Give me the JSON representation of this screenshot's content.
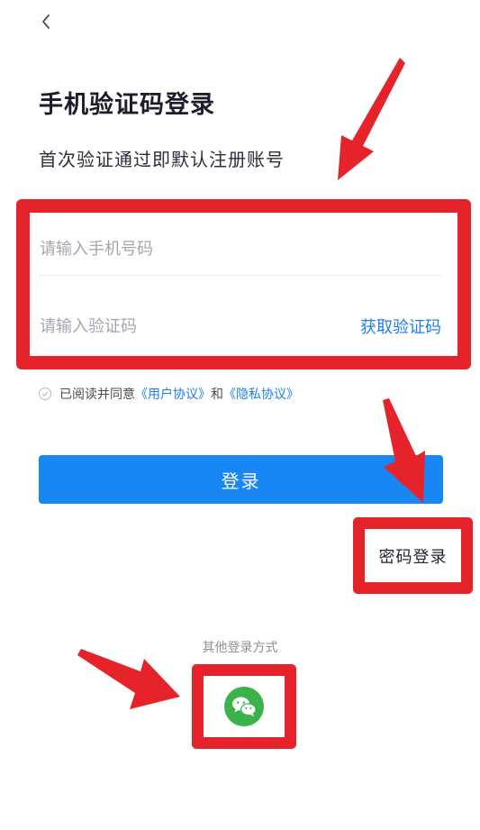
{
  "header": {
    "back_icon": "chevron-left-icon"
  },
  "title": "手机验证码登录",
  "subtitle": "首次验证通过即默认注册账号",
  "form": {
    "phone_placeholder": "请输入手机号码",
    "code_placeholder": "请输入验证码",
    "get_code_label": "获取验证码"
  },
  "agreement": {
    "prefix": "已阅读并同意",
    "user_agreement": "《用户协议》",
    "conjunction": "和",
    "privacy_policy": "《隐私协议》"
  },
  "login_button": "登录",
  "password_login": "密码登录",
  "other_login": {
    "label": "其他登录方式",
    "wechat_icon": "wechat-icon"
  },
  "colors": {
    "accent": "#1887f4",
    "link": "#1e7ee8",
    "highlight": "#e5232a",
    "wechat": "#3cb34a"
  }
}
